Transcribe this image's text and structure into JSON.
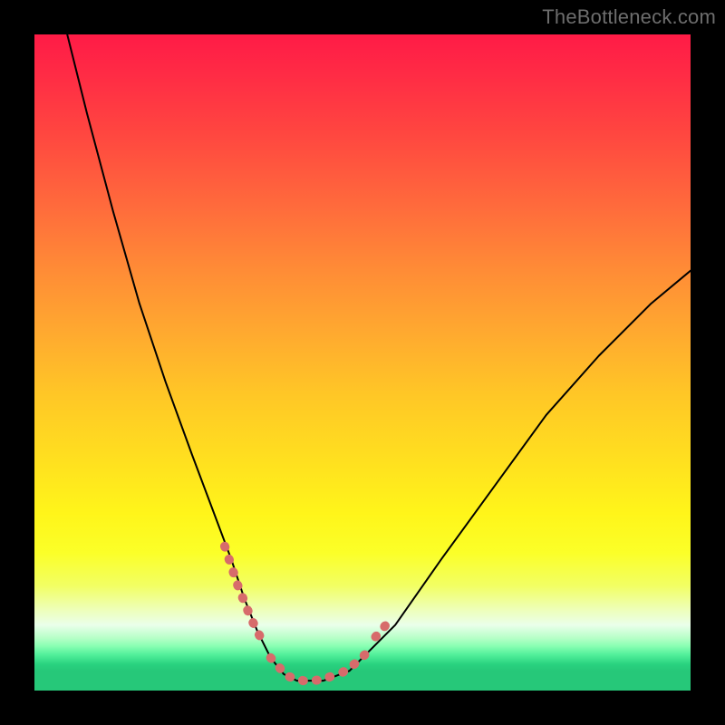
{
  "watermark": "TheBottleneck.com",
  "chart_data": {
    "type": "line",
    "title": "",
    "xlabel": "",
    "ylabel": "",
    "xlim": [
      0,
      100
    ],
    "ylim": [
      0,
      100
    ],
    "grid": false,
    "legend": false,
    "background_gradient_stops": [
      {
        "pos": 0,
        "color": "#ff1b46"
      },
      {
        "pos": 0.06,
        "color": "#ff2b45"
      },
      {
        "pos": 0.15,
        "color": "#ff4640"
      },
      {
        "pos": 0.26,
        "color": "#ff6a3c"
      },
      {
        "pos": 0.36,
        "color": "#ff8c36"
      },
      {
        "pos": 0.46,
        "color": "#ffab2f"
      },
      {
        "pos": 0.55,
        "color": "#ffc726"
      },
      {
        "pos": 0.65,
        "color": "#ffe01f"
      },
      {
        "pos": 0.73,
        "color": "#fff51a"
      },
      {
        "pos": 0.79,
        "color": "#fbff28"
      },
      {
        "pos": 0.84,
        "color": "#f2ff63"
      },
      {
        "pos": 0.875,
        "color": "#eeffb5"
      },
      {
        "pos": 0.9,
        "color": "#eaffea"
      },
      {
        "pos": 0.92,
        "color": "#b6ffc7"
      },
      {
        "pos": 0.945,
        "color": "#53f09b"
      },
      {
        "pos": 0.96,
        "color": "#29d27f"
      },
      {
        "pos": 1.0,
        "color": "#26c879"
      }
    ],
    "series": [
      {
        "name": "bottleneck-curve",
        "color": "#000000",
        "stroke_width": 2,
        "x": [
          5,
          8,
          12,
          16,
          20,
          24,
          27,
          30,
          32,
          34,
          36,
          38,
          40,
          44,
          48,
          55,
          62,
          70,
          78,
          86,
          94,
          100
        ],
        "y": [
          100,
          88,
          73,
          59,
          47,
          36,
          28,
          20,
          14,
          9,
          5,
          2.5,
          1.5,
          1.5,
          3,
          10,
          20,
          31,
          42,
          51,
          59,
          64
        ]
      },
      {
        "name": "highlight-segments",
        "color": "#d76b6b",
        "stroke_width": 10,
        "segments": [
          {
            "x": [
              29,
              31,
              33,
              35
            ],
            "y": [
              22,
              16,
              11,
              7
            ]
          },
          {
            "x": [
              36,
              38.5,
              41,
              43.5,
              46
            ],
            "y": [
              5,
              2.2,
              1.5,
              1.6,
              2.4
            ]
          },
          {
            "x": [
              47,
              49,
              50.5
            ],
            "y": [
              2.8,
              4.2,
              5.6
            ]
          },
          {
            "x": [
              52,
              54
            ],
            "y": [
              8.2,
              10.5
            ]
          }
        ]
      }
    ]
  }
}
